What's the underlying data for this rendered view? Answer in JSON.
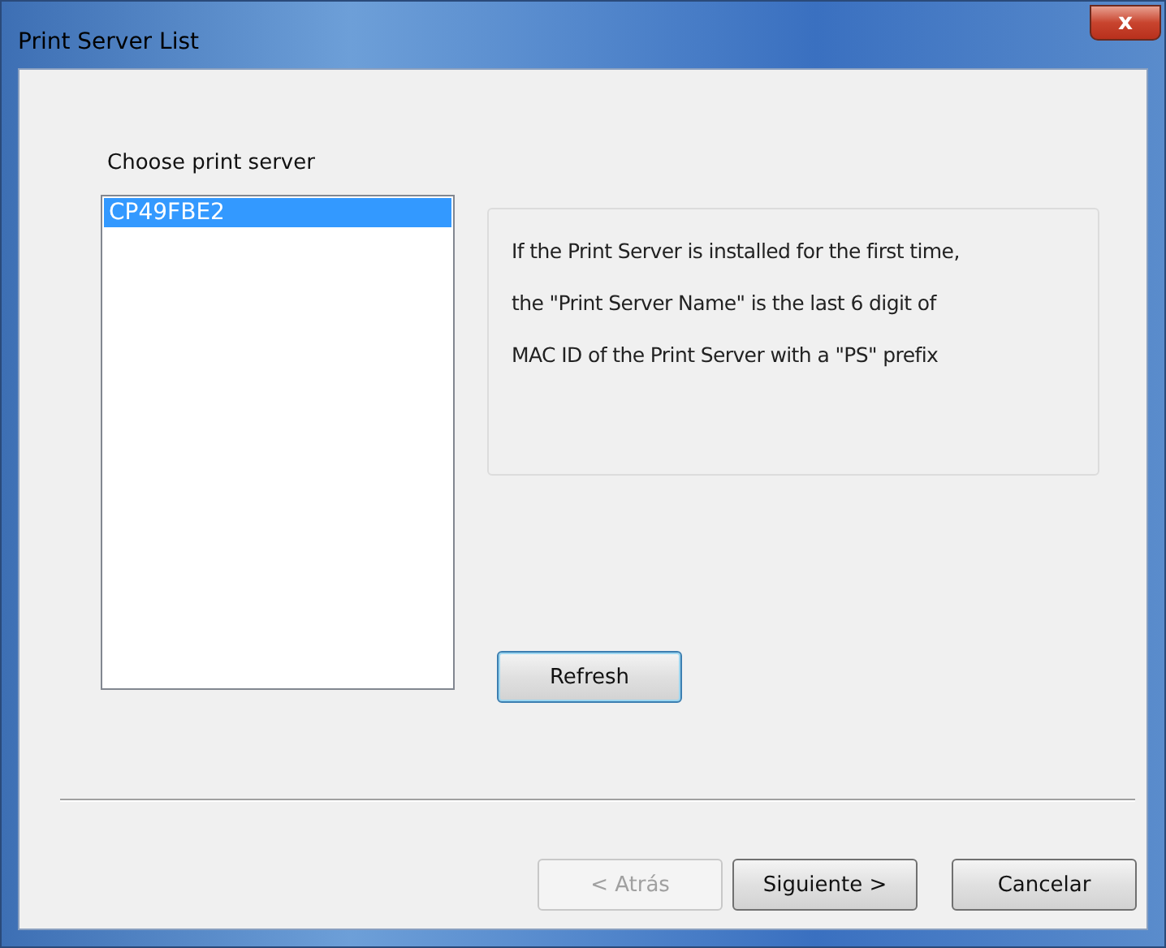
{
  "window": {
    "title": "Print Server List",
    "close_label": "x"
  },
  "list_label": "Choose print server",
  "servers": [
    {
      "name": "CP49FBE2",
      "selected": true
    }
  ],
  "info_lines": [
    "If the Print Server is installed for the first time,",
    "the \"Print Server Name\" is the last 6 digit of",
    "MAC ID of the Print Server with a \"PS\" prefix"
  ],
  "refresh": {
    "label": "Refresh",
    "focused": true
  },
  "buttons": [
    {
      "label": "< Atrás",
      "disabled": true
    },
    {
      "label": "Siguiente >",
      "disabled": false
    },
    {
      "label": "Cancelar",
      "disabled": false
    }
  ]
}
